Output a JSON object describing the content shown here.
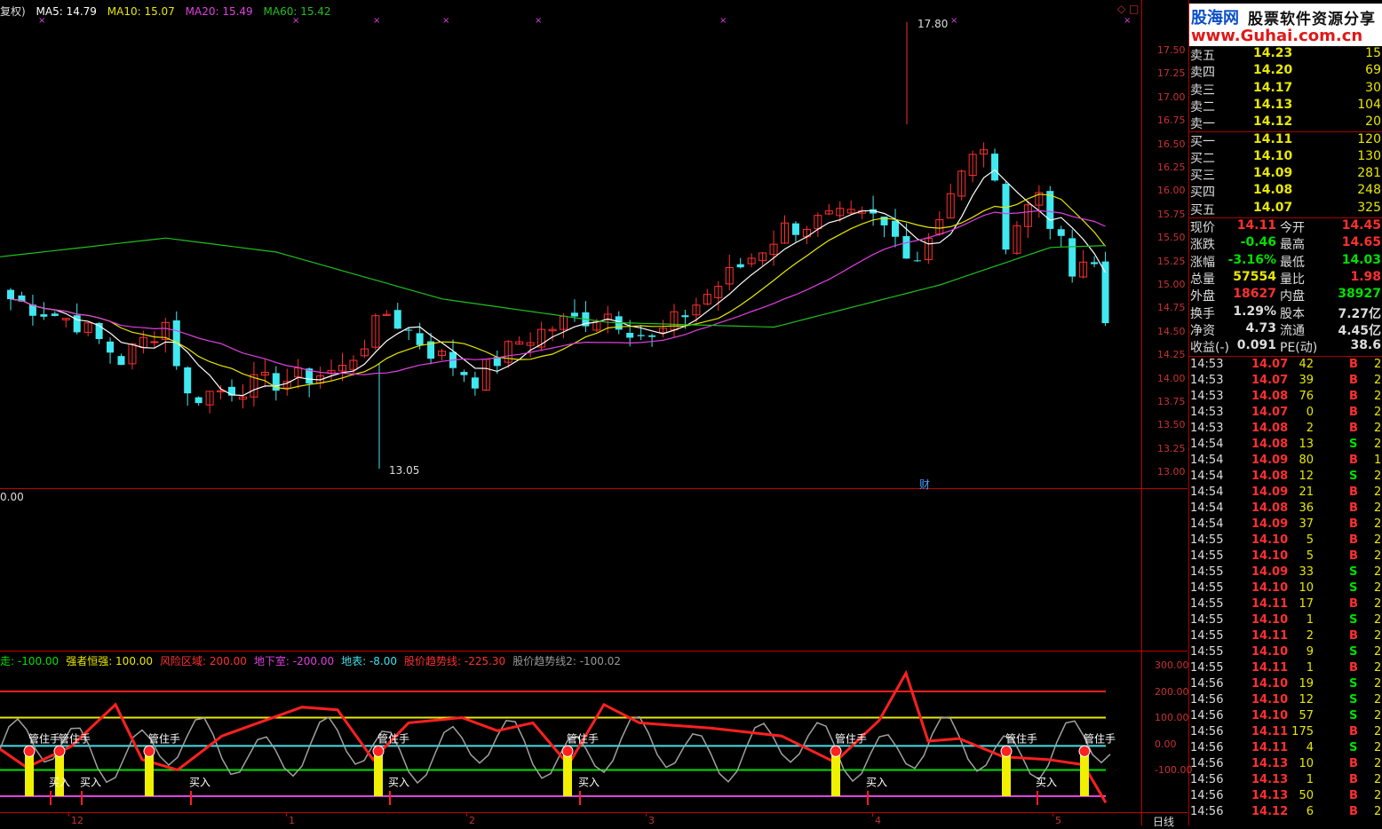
{
  "header": {
    "prefix": "复权)",
    "ma5": "MA5: 14.79",
    "ma10": "MA10: 15.07",
    "ma20": "MA20: 15.49",
    "ma60": "MA60: 15.42",
    "corner_icons": "◇ □"
  },
  "price_axis": [
    "17.50",
    "17.25",
    "17.00",
    "16.75",
    "16.50",
    "16.25",
    "16.00",
    "15.75",
    "15.50",
    "15.25",
    "15.00",
    "14.75",
    "14.50",
    "14.25",
    "14.00",
    "13.75",
    "13.50",
    "13.25",
    "13.00"
  ],
  "price_annotations": {
    "high": "17.80",
    "low": "13.05",
    "fin_marker": "财"
  },
  "volume_panel": {
    "value": "0.00"
  },
  "indicator": {
    "items": [
      {
        "text": "走: -100.00",
        "color": "#00e000"
      },
      {
        "text": "强者恒强: 100.00",
        "color": "#e8e800"
      },
      {
        "text": "风险区域: 200.00",
        "color": "#ff3030"
      },
      {
        "text": "地下室: -200.00",
        "color": "#e040e0"
      },
      {
        "text": "地表: -8.00",
        "color": "#40e0e8"
      },
      {
        "text": "股价趋势线: -225.30",
        "color": "#ff3030"
      },
      {
        "text": "股价趋势线2: -100.02",
        "color": "#999999"
      }
    ],
    "axis": [
      "300.00",
      "200.00",
      "100.00",
      "0.00",
      "-100.00"
    ],
    "signal_top": "管住手",
    "signal_buy": "买入"
  },
  "x_axis": {
    "labels": [
      "12",
      "1",
      "2",
      "3",
      "4",
      "5"
    ],
    "period": "日线"
  },
  "brand": {
    "logo_cn": "股海网",
    "logo_slogan": "股票软件资源分享",
    "logo_url": "www.Guhai.com.cn"
  },
  "order_book": [
    {
      "label": "卖五",
      "price": "14.23",
      "vol": "15"
    },
    {
      "label": "卖四",
      "price": "14.20",
      "vol": "69"
    },
    {
      "label": "卖三",
      "price": "14.17",
      "vol": "30"
    },
    {
      "label": "卖二",
      "price": "14.13",
      "vol": "104"
    },
    {
      "label": "卖一",
      "price": "14.12",
      "vol": "20"
    },
    {
      "label": "买一",
      "price": "14.11",
      "vol": "120"
    },
    {
      "label": "买二",
      "price": "14.10",
      "vol": "130"
    },
    {
      "label": "买三",
      "price": "14.09",
      "vol": "281"
    },
    {
      "label": "买四",
      "price": "14.08",
      "vol": "248"
    },
    {
      "label": "买五",
      "price": "14.07",
      "vol": "325"
    }
  ],
  "stats": [
    {
      "k1": "现价",
      "v1": "14.11",
      "c1": "#ff3030",
      "k2": "今开",
      "v2": "14.45",
      "c2": "#ff3030"
    },
    {
      "k1": "涨跌",
      "v1": "-0.46",
      "c1": "#00e000",
      "k2": "最高",
      "v2": "14.65",
      "c2": "#ff3030"
    },
    {
      "k1": "涨幅",
      "v1": "-3.16%",
      "c1": "#00e000",
      "k2": "最低",
      "v2": "14.03",
      "c2": "#00e000"
    },
    {
      "k1": "总量",
      "v1": "57554",
      "c1": "#e8e800",
      "k2": "量比",
      "v2": "1.98",
      "c2": "#ff3030"
    },
    {
      "k1": "外盘",
      "v1": "18627",
      "c1": "#ff3030",
      "k2": "内盘",
      "v2": "38927",
      "c2": "#00e000"
    },
    {
      "k1": "换手",
      "v1": "1.29%",
      "c1": "#ddd",
      "k2": "股本",
      "v2": "7.27亿",
      "c2": "#ddd"
    },
    {
      "k1": "净资",
      "v1": "4.73",
      "c1": "#ddd",
      "k2": "流通",
      "v2": "4.45亿",
      "c2": "#ddd"
    },
    {
      "k1": "收益(-)",
      "v1": "0.091",
      "c1": "#ddd",
      "k2": "PE(动)",
      "v2": "38.6",
      "c2": "#ddd"
    }
  ],
  "ticks": [
    {
      "t": "14:53",
      "p": "14.07",
      "v": "42",
      "bs": "B",
      "n": "2"
    },
    {
      "t": "14:53",
      "p": "14.07",
      "v": "39",
      "bs": "B",
      "n": "2"
    },
    {
      "t": "14:53",
      "p": "14.08",
      "v": "76",
      "bs": "B",
      "n": "2"
    },
    {
      "t": "14:53",
      "p": "14.07",
      "v": "0",
      "bs": "B",
      "n": "2"
    },
    {
      "t": "14:53",
      "p": "14.08",
      "v": "2",
      "bs": "B",
      "n": "2"
    },
    {
      "t": "14:54",
      "p": "14.08",
      "v": "13",
      "bs": "S",
      "n": "2"
    },
    {
      "t": "14:54",
      "p": "14.09",
      "v": "80",
      "bs": "B",
      "n": "1"
    },
    {
      "t": "14:54",
      "p": "14.08",
      "v": "12",
      "bs": "S",
      "n": "2"
    },
    {
      "t": "14:54",
      "p": "14.09",
      "v": "21",
      "bs": "B",
      "n": "2"
    },
    {
      "t": "14:54",
      "p": "14.08",
      "v": "36",
      "bs": "B",
      "n": "2"
    },
    {
      "t": "14:54",
      "p": "14.09",
      "v": "37",
      "bs": "B",
      "n": "2"
    },
    {
      "t": "14:55",
      "p": "14.10",
      "v": "5",
      "bs": "B",
      "n": "2"
    },
    {
      "t": "14:55",
      "p": "14.10",
      "v": "5",
      "bs": "B",
      "n": "2"
    },
    {
      "t": "14:55",
      "p": "14.09",
      "v": "33",
      "bs": "S",
      "n": "2"
    },
    {
      "t": "14:55",
      "p": "14.10",
      "v": "10",
      "bs": "S",
      "n": "2"
    },
    {
      "t": "14:55",
      "p": "14.11",
      "v": "17",
      "bs": "B",
      "n": "2"
    },
    {
      "t": "14:55",
      "p": "14.10",
      "v": "1",
      "bs": "S",
      "n": "2"
    },
    {
      "t": "14:55",
      "p": "14.11",
      "v": "2",
      "bs": "B",
      "n": "2"
    },
    {
      "t": "14:55",
      "p": "14.10",
      "v": "9",
      "bs": "S",
      "n": "2"
    },
    {
      "t": "14:55",
      "p": "14.11",
      "v": "1",
      "bs": "B",
      "n": "2"
    },
    {
      "t": "14:56",
      "p": "14.10",
      "v": "19",
      "bs": "S",
      "n": "2"
    },
    {
      "t": "14:56",
      "p": "14.10",
      "v": "12",
      "bs": "S",
      "n": "2"
    },
    {
      "t": "14:56",
      "p": "14.10",
      "v": "57",
      "bs": "S",
      "n": "2"
    },
    {
      "t": "14:56",
      "p": "14.11",
      "v": "175",
      "bs": "B",
      "n": "2"
    },
    {
      "t": "14:56",
      "p": "14.11",
      "v": "4",
      "bs": "S",
      "n": "2"
    },
    {
      "t": "14:56",
      "p": "14.13",
      "v": "10",
      "bs": "B",
      "n": "2"
    },
    {
      "t": "14:56",
      "p": "14.13",
      "v": "1",
      "bs": "B",
      "n": "2"
    },
    {
      "t": "14:56",
      "p": "14.13",
      "v": "50",
      "bs": "B",
      "n": "2"
    },
    {
      "t": "14:56",
      "p": "14.12",
      "v": "6",
      "bs": "B",
      "n": "2"
    }
  ],
  "colors": {
    "up": "#ff3030",
    "down": "#40e8f0",
    "ma5": "#ffffff",
    "ma10": "#e8e800",
    "ma20": "#e040e0",
    "ma60": "#20c020",
    "border": "#c00000"
  }
}
